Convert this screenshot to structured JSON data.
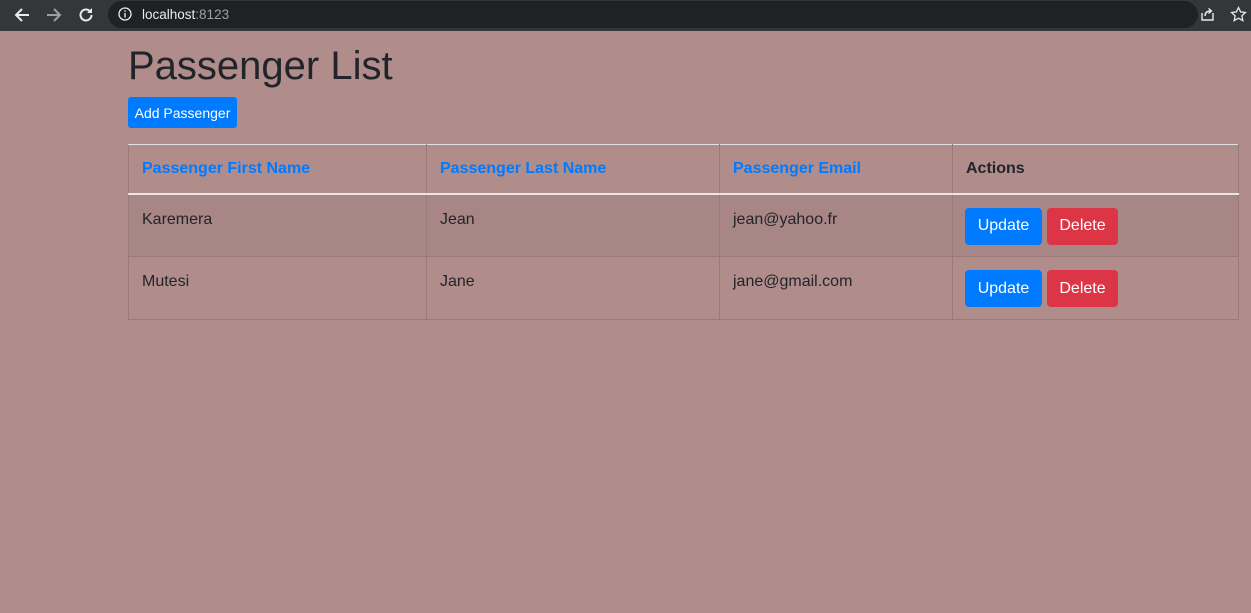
{
  "browser": {
    "url_host": "localhost",
    "url_port": ":8123"
  },
  "page": {
    "title": "Passenger List",
    "add_button": "Add Passenger"
  },
  "table": {
    "headers": [
      "Passenger First Name",
      "Passenger Last Name",
      "Passenger Email",
      "Actions"
    ],
    "rows": [
      {
        "first": "Karemera",
        "last": "Jean",
        "email": "jean@yahoo.fr",
        "update": "Update",
        "delete": "Delete"
      },
      {
        "first": "Mutesi",
        "last": "Jane",
        "email": "jane@gmail.com",
        "update": "Update",
        "delete": "Delete"
      }
    ]
  },
  "colors": {
    "background": "#b08c8b",
    "primary": "#007bff",
    "danger": "#dc3545"
  },
  "icons": [
    "back-arrow-icon",
    "forward-arrow-icon",
    "reload-icon",
    "info-icon",
    "share-icon",
    "star-icon"
  ]
}
